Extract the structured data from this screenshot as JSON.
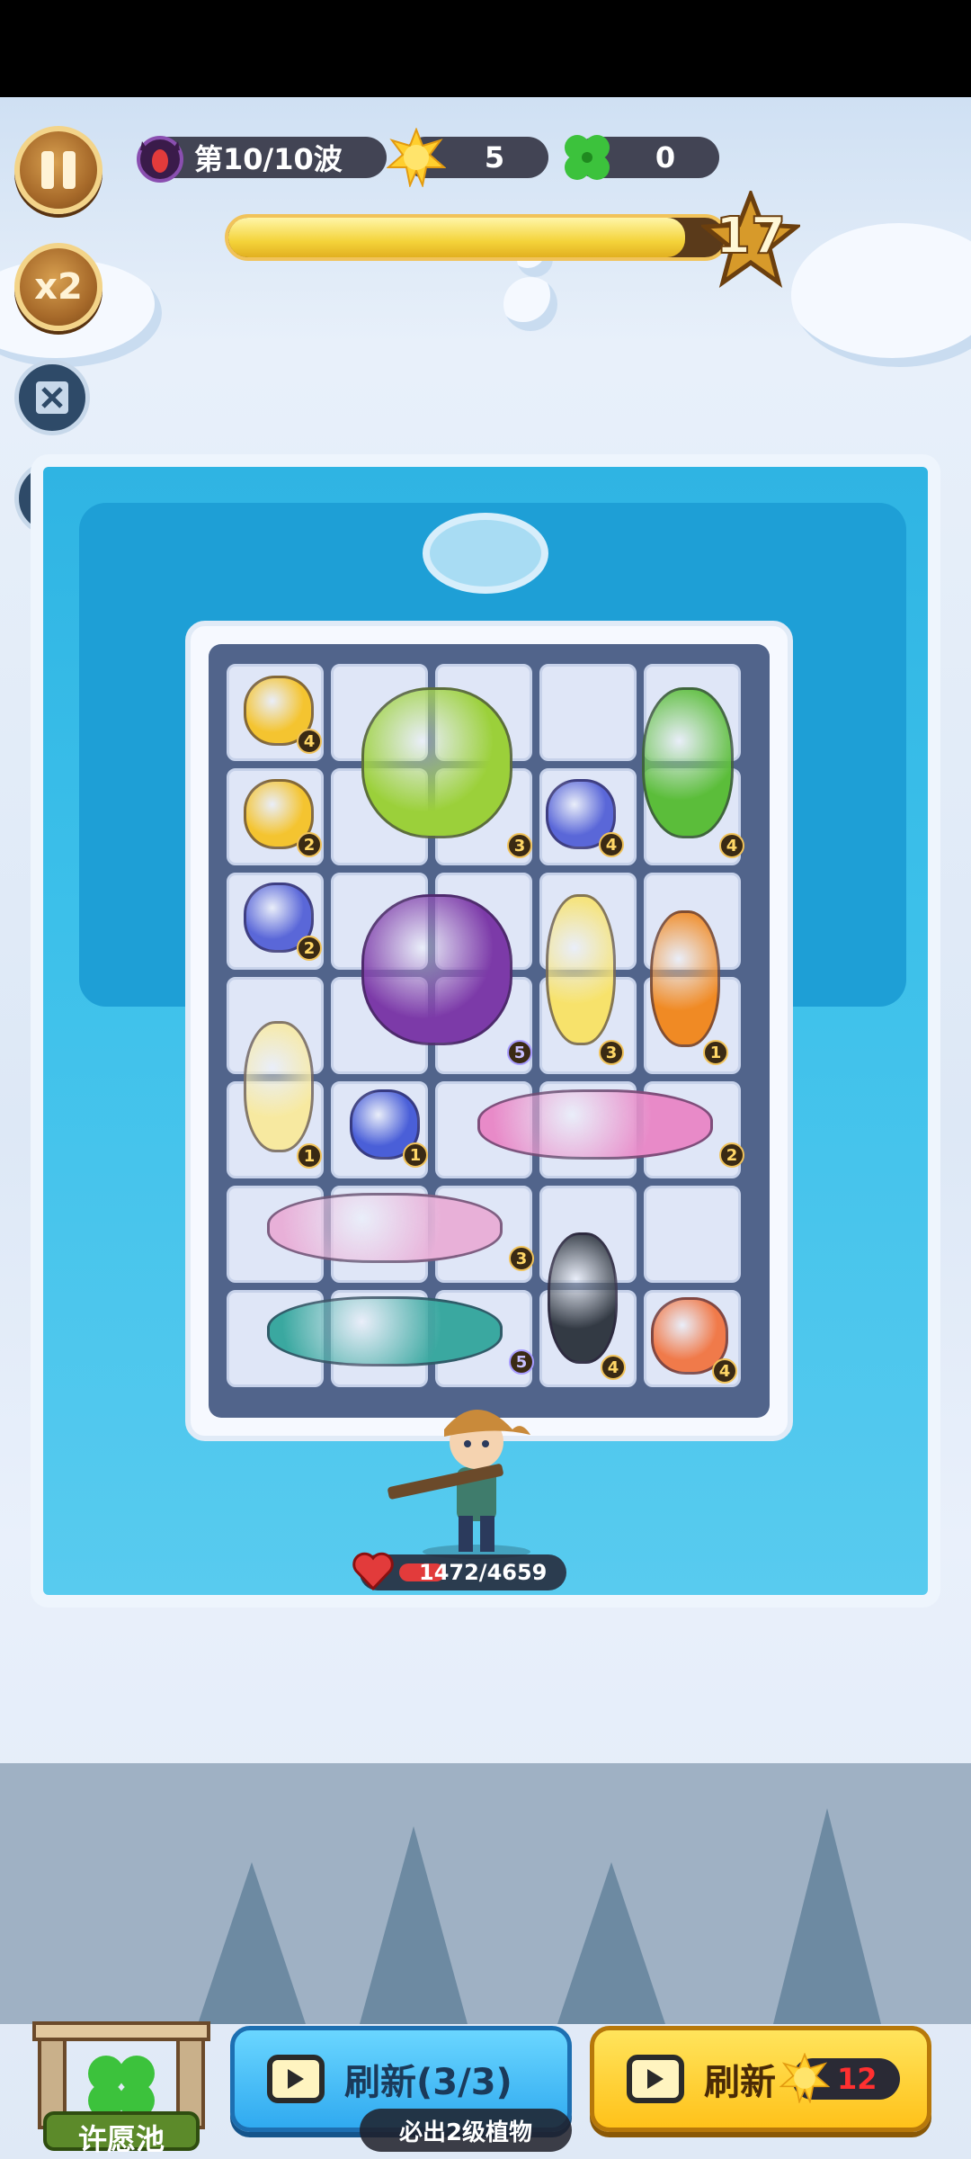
{
  "hud": {
    "wave_label": "第10/10波",
    "sun_count": "5",
    "clover_count": "0",
    "speed_label": "x2",
    "level_number": "17",
    "wave_progress_percent": 92
  },
  "hero": {
    "hp_text": "1472/4659",
    "hp_fraction": 0.32
  },
  "board": {
    "cells": [
      {
        "label": "4"
      },
      {
        "label": "2"
      },
      {
        "label": "3"
      },
      {
        "label": "4"
      },
      {
        "label": "4"
      },
      {
        "label": "2"
      },
      {
        "label": "5"
      },
      {
        "label": "3"
      },
      {
        "label": "1"
      },
      {
        "label": "1"
      },
      {
        "label": "1"
      },
      {
        "label": "2"
      },
      {
        "label": "3"
      },
      {
        "label": "4"
      },
      {
        "label": "5"
      },
      {
        "label": "4"
      }
    ]
  },
  "bottom": {
    "wish_pool_label": "许愿池",
    "refresh_free_label": "刷新(3/3)",
    "refresh_note": "必出2级植物",
    "refresh_paid_label": "刷新",
    "refresh_cost": "12"
  },
  "colors": {
    "accent_gold": "#f1c35a",
    "pond_blue": "#2fb4e3",
    "button_blue": "#30aaf0",
    "button_yellow": "#ffc21a",
    "hp_red": "#e23b3b"
  }
}
